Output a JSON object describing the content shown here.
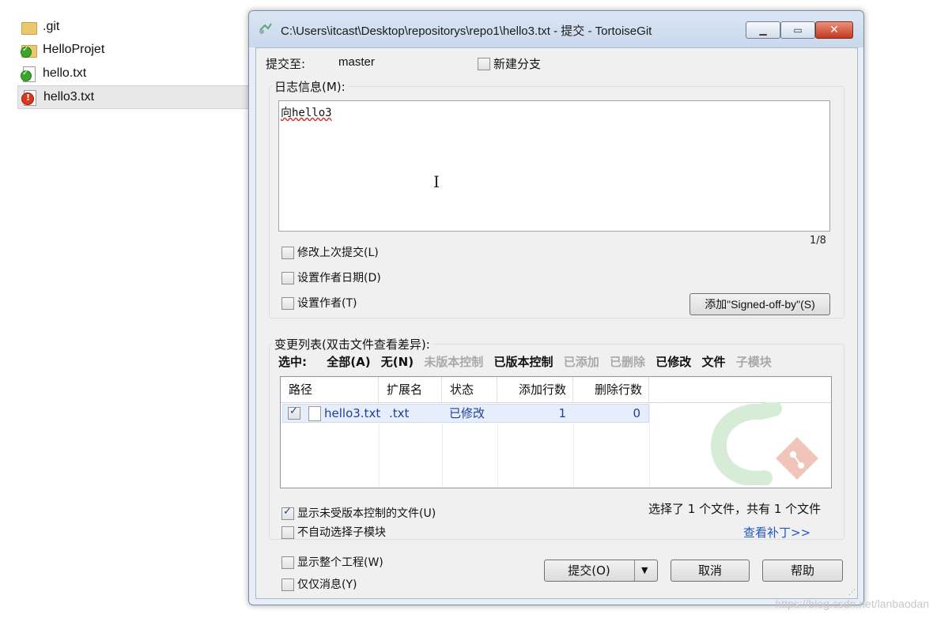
{
  "explorer": {
    "files": [
      {
        "name": ".git",
        "icon": "folder-icon"
      },
      {
        "name": "HelloProjet",
        "icon": "folder-clean-icon"
      },
      {
        "name": "hello.txt",
        "icon": "file-clean-icon"
      },
      {
        "name": "hello3.txt",
        "icon": "file-modified-icon"
      }
    ]
  },
  "dialog": {
    "title": "C:\\Users\\itcast\\Desktop\\repositorys\\repo1\\hello3.txt - 提交 - TortoiseGit",
    "commit_to_label": "提交至:",
    "branch": "master",
    "new_branch_label": "新建分支",
    "message_group_label": "日志信息(M):",
    "message_text": "向hello3",
    "message_counter": "1/8",
    "amend_label": "修改上次提交(L)",
    "set_date_label": "设置作者日期(D)",
    "set_author_label": "设置作者(T)",
    "signoff_button": "添加\"Signed-off-by\"(S)",
    "changes_group_label": "变更列表(双击文件查看差异):",
    "select_label": "选中:",
    "filters": [
      {
        "label": "全部(A)",
        "enabled": true
      },
      {
        "label": "无(N)",
        "enabled": true
      },
      {
        "label": "未版本控制",
        "enabled": false
      },
      {
        "label": "已版本控制",
        "enabled": true
      },
      {
        "label": "已添加",
        "enabled": false
      },
      {
        "label": "已删除",
        "enabled": false
      },
      {
        "label": "已修改",
        "enabled": true
      },
      {
        "label": "文件",
        "enabled": true
      },
      {
        "label": "子模块",
        "enabled": false
      }
    ],
    "table": {
      "headers": [
        "路径",
        "扩展名",
        "状态",
        "添加行数",
        "删除行数"
      ],
      "rows": [
        {
          "checked": true,
          "path": "hello3.txt",
          "ext": ".txt",
          "status": "已修改",
          "added": "1",
          "deleted": "0"
        }
      ]
    },
    "show_unversioned_label": "显示未受版本控制的文件(U)",
    "no_autoselect_label": "不自动选择子模块",
    "selection_info": "选择了 1 个文件，共有 1 个文件",
    "view_patch_link": "查看补丁>>",
    "show_whole_project_label": "显示整个工程(W)",
    "message_only_label": "仅仅消息(Y)",
    "commit_button": "提交(O)",
    "cancel_button": "取消",
    "help_button": "帮助"
  },
  "watermark": "https://blog.csdn.net/lanbaodan"
}
